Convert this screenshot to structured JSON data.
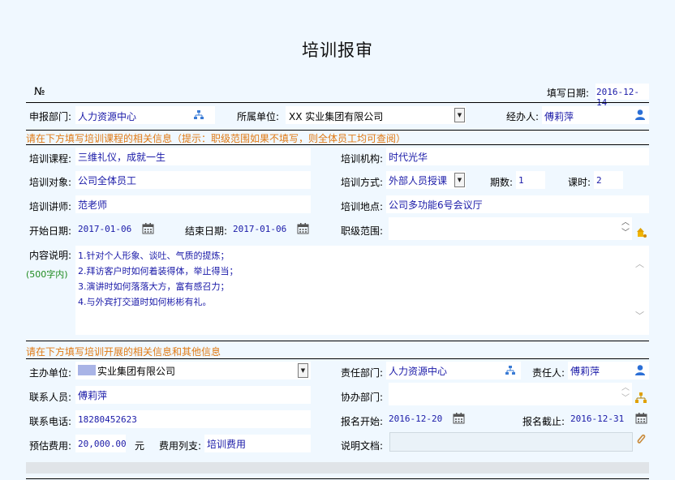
{
  "page_title": "培训报审",
  "header": {
    "no_label": "№",
    "fill_date_label": "填写日期:",
    "fill_date": "2016-12-14"
  },
  "row1": {
    "dept_label": "申报部门:",
    "dept_value": "人力资源中心",
    "unit_label": "所属单位:",
    "unit_value": "XX 实业集团有限公司",
    "handler_label": "经办人:",
    "handler_value": "傅莉萍"
  },
  "section1_hint": "请在下方填写培训课程的相关信息（提示：职级范围如果不填写，则全体员工均可查阅）",
  "course": {
    "course_label": "培训课程:",
    "course_value": "三维礼仪，成就一生",
    "org_label": "培训机构:",
    "org_value": "时代光华",
    "target_label": "培训对象:",
    "target_value": "公司全体员工",
    "method_label": "培训方式:",
    "method_value": "外部人员授课",
    "periods_label": "期数:",
    "periods_value": "1",
    "hours_label": "课时:",
    "hours_value": "2",
    "teacher_label": "培训讲师:",
    "teacher_value": "范老师",
    "place_label": "培训地点:",
    "place_value": "公司多功能6号会议厅",
    "start_label": "开始日期:",
    "start_value": "2017-01-06",
    "end_label": "结束日期:",
    "end_value": "2017-01-06",
    "rank_label": "职级范围:",
    "rank_value": "",
    "desc_label": "内容说明:",
    "desc_hint": "(500字内)",
    "desc_lines": [
      "1.针对个人形象、谈吐、气质的提炼；",
      "2.拜访客户时如何着装得体，举止得当；",
      "3.演讲时如何落落大方，富有感召力；",
      "4.与外宾打交道时如何彬彬有礼。"
    ]
  },
  "section2_hint": "请在下方填写培训开展的相关信息和其他信息",
  "other": {
    "host_label": "主办单位:",
    "host_value": "实业集团有限公司",
    "resp_dept_label": "责任部门:",
    "resp_dept_value": "人力资源中心",
    "resp_person_label": "责任人:",
    "resp_person_value": "傅莉萍",
    "contact_label": "联系人员:",
    "contact_value": "傅莉萍",
    "assist_label": "协办部门:",
    "assist_value": "",
    "phone_label": "联系电话:",
    "phone_value": "18280452623",
    "reg_start_label": "报名开始:",
    "reg_start_value": "2016-12-20",
    "reg_end_label": "报名截止:",
    "reg_end_value": "2016-12-31",
    "budget_label": "预估费用:",
    "budget_value": "20,000.00",
    "budget_unit": "元",
    "expense_label": "费用列支:",
    "expense_value": "培训费用",
    "doc_label": "说明文档:"
  },
  "colors": {
    "background": "#f0f8ff",
    "value_text": "#1a1aa8",
    "section_hint": "#e07a14",
    "person_icon": "#2b6fd6",
    "org_icon": "#3a7bd5",
    "rank_icon": "#e0a000"
  },
  "icons": {
    "org": "org-tree-icon",
    "person": "person-icon",
    "calendar": "calendar-icon",
    "rank": "group-icon",
    "attach": "paperclip-icon",
    "dropdown": "dropdown-arrow-icon"
  }
}
